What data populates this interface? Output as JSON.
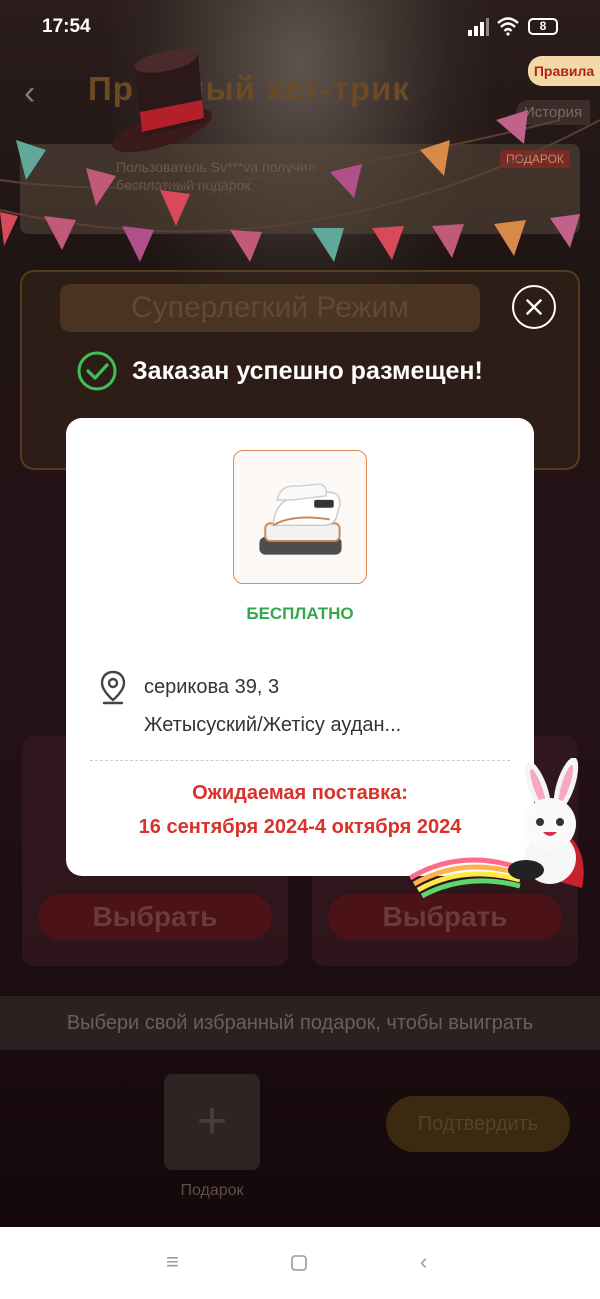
{
  "status_bar": {
    "time": "17:54",
    "battery": "8"
  },
  "background": {
    "title": "Пр очный хет-трик",
    "rules_label": "Правила",
    "history_label": "История",
    "ticker_line1": "Пользователь Sv***va получил",
    "ticker_line2": "бесплатный подарок",
    "ticker_badge": "ПОДАРОК",
    "mode_title": "Суперлегкий Режим",
    "pick_left": "Выбрать",
    "pick_right": "Выбрать",
    "choose_text": "Выбери свой избранный подарок, чтобы выиграть",
    "gift_slot_label": "Подарок",
    "confirm_label": "Подтвердить"
  },
  "overlay": {
    "success_message": "Заказан успешно размещен!",
    "price_label": "БЕСПЛАТНО",
    "address_line1": "серикова 39, 3",
    "address_line2": "Жетысуский/Жетісу аудан...",
    "eta_title": "Ожидаемая поставка:",
    "eta_dates": "16 сентября 2024-4 октября 2024"
  },
  "colors": {
    "success_green": "#33a84a",
    "eta_red": "#d9322b",
    "rules_bg": "#f3d9a5"
  },
  "icons": [
    "signal-icon",
    "wifi-icon",
    "battery-icon",
    "back-arrow-icon",
    "close-icon",
    "check-circle-icon",
    "location-pin-icon",
    "plus-icon",
    "menu-nav-icon",
    "home-nav-icon",
    "back-nav-icon"
  ]
}
